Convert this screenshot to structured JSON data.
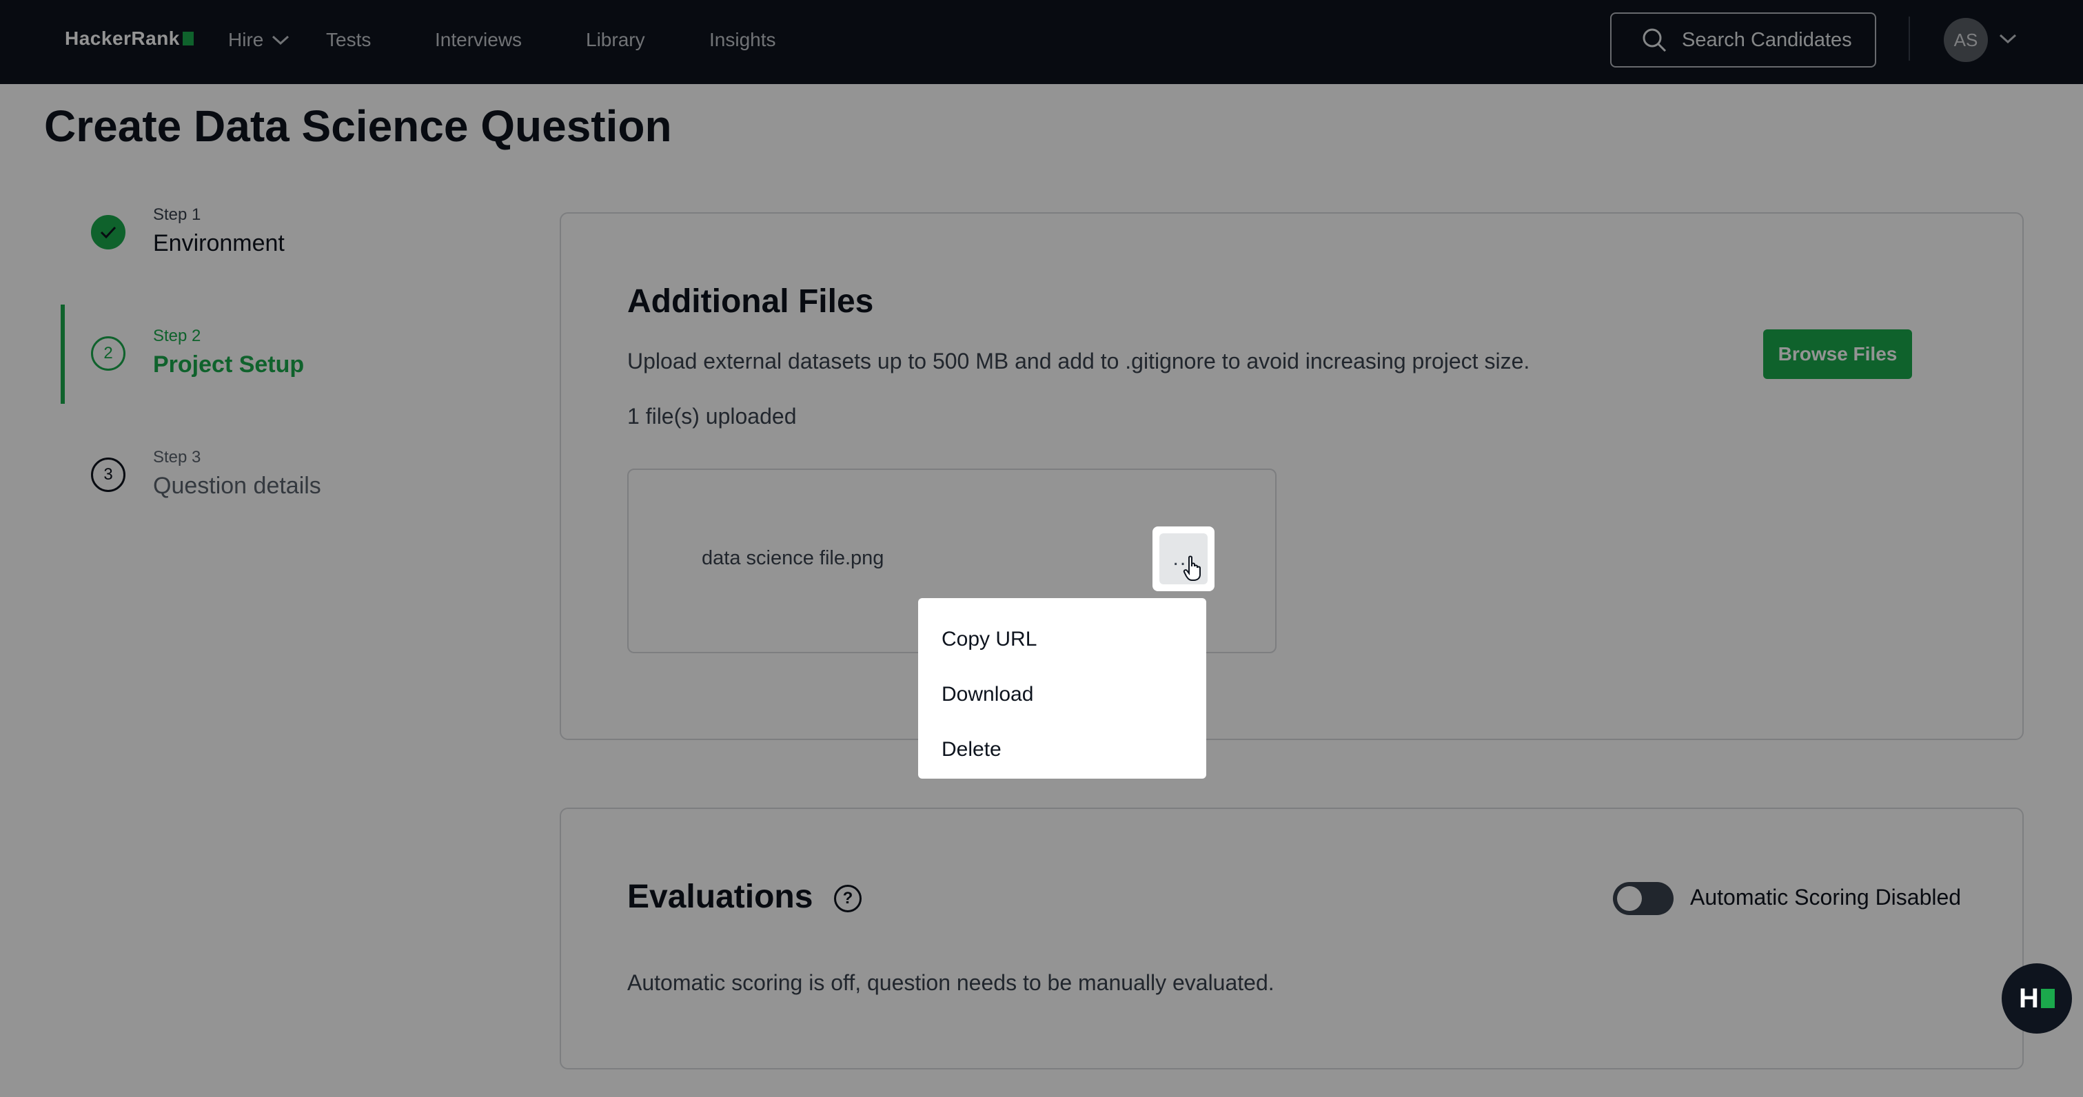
{
  "nav": {
    "logo": "HackerRank",
    "items": [
      {
        "label": "Hire"
      },
      {
        "label": "Tests"
      },
      {
        "label": "Interviews"
      },
      {
        "label": "Library"
      },
      {
        "label": "Insights"
      }
    ],
    "search_label": "Search Candidates",
    "avatar_initials": "AS"
  },
  "page": {
    "title": "Create Data Science Question"
  },
  "steps": [
    {
      "step": "Step 1",
      "name": "Environment",
      "state": "complete"
    },
    {
      "step": "Step 2",
      "name": "Project Setup",
      "state": "active",
      "number": "2"
    },
    {
      "step": "Step 3",
      "name": "Question details",
      "state": "pending",
      "number": "3"
    }
  ],
  "files": {
    "title": "Additional Files",
    "description": "Upload external datasets up to 500 MB and add to .gitignore to avoid increasing project size.",
    "browse_label": "Browse Files",
    "count_text": "1 file(s) uploaded",
    "items": [
      {
        "name": "data science file.png",
        "more_label": "..."
      }
    ],
    "menu": [
      "Copy URL",
      "Download",
      "Delete"
    ]
  },
  "evaluations": {
    "title": "Evaluations",
    "help_glyph": "?",
    "toggle_label": "Automatic Scoring Disabled",
    "toggle_on": false,
    "description": "Automatic scoring is off, question needs to be manually evaluated."
  },
  "fab": {
    "label": "H"
  },
  "colors": {
    "brand": "#1ba94c",
    "nav_bg": "#0e141e"
  }
}
